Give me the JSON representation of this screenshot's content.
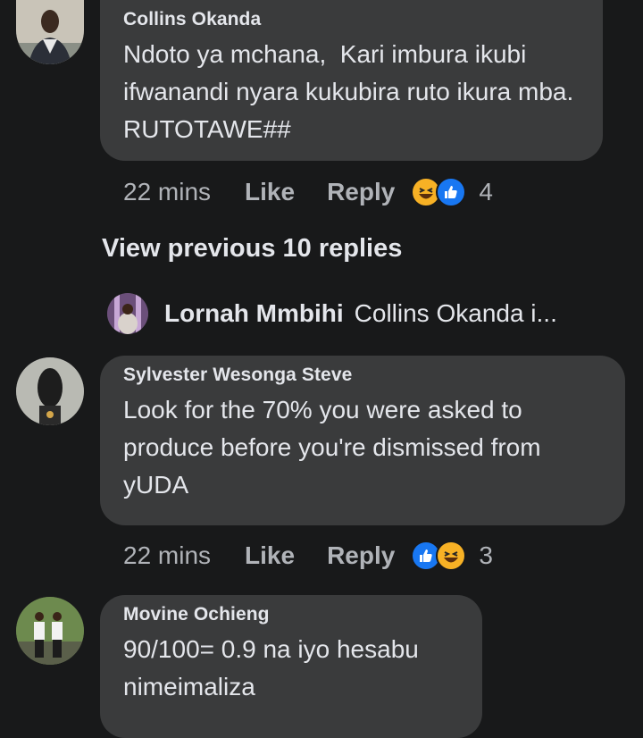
{
  "comments": [
    {
      "author": "Collins Okanda",
      "text": "Ndoto ya mchana,  Kari imbura ikubi ifwanandi nyara kukubira ruto ikura mba.  RUTOTAWE##",
      "time": "22 mins",
      "like_label": "Like",
      "reply_label": "Reply",
      "reactions": [
        "haha",
        "like"
      ],
      "reaction_count": "4"
    },
    {
      "author": "Sylvester Wesonga Steve",
      "text": "Look for the 70% you were asked to produce before you're dismissed from yUDA",
      "time": "22 mins",
      "like_label": "Like",
      "reply_label": "Reply",
      "reactions": [
        "like",
        "haha"
      ],
      "reaction_count": "3"
    },
    {
      "author": "Movine Ochieng",
      "text": "90/100= 0.9 na iyo hesabu nimeimaliza"
    }
  ],
  "view_previous_label": "View previous 10 replies",
  "collapsed_reply": {
    "author": "Lornah Mmbihi",
    "preview": "Collins Okanda i..."
  },
  "colors": {
    "background": "#18191a",
    "bubble": "#3a3b3c",
    "text": "#e4e6eb",
    "meta": "#b0b3b8",
    "like_blue": "#1877f2",
    "haha_yellow": "#f7b125"
  }
}
